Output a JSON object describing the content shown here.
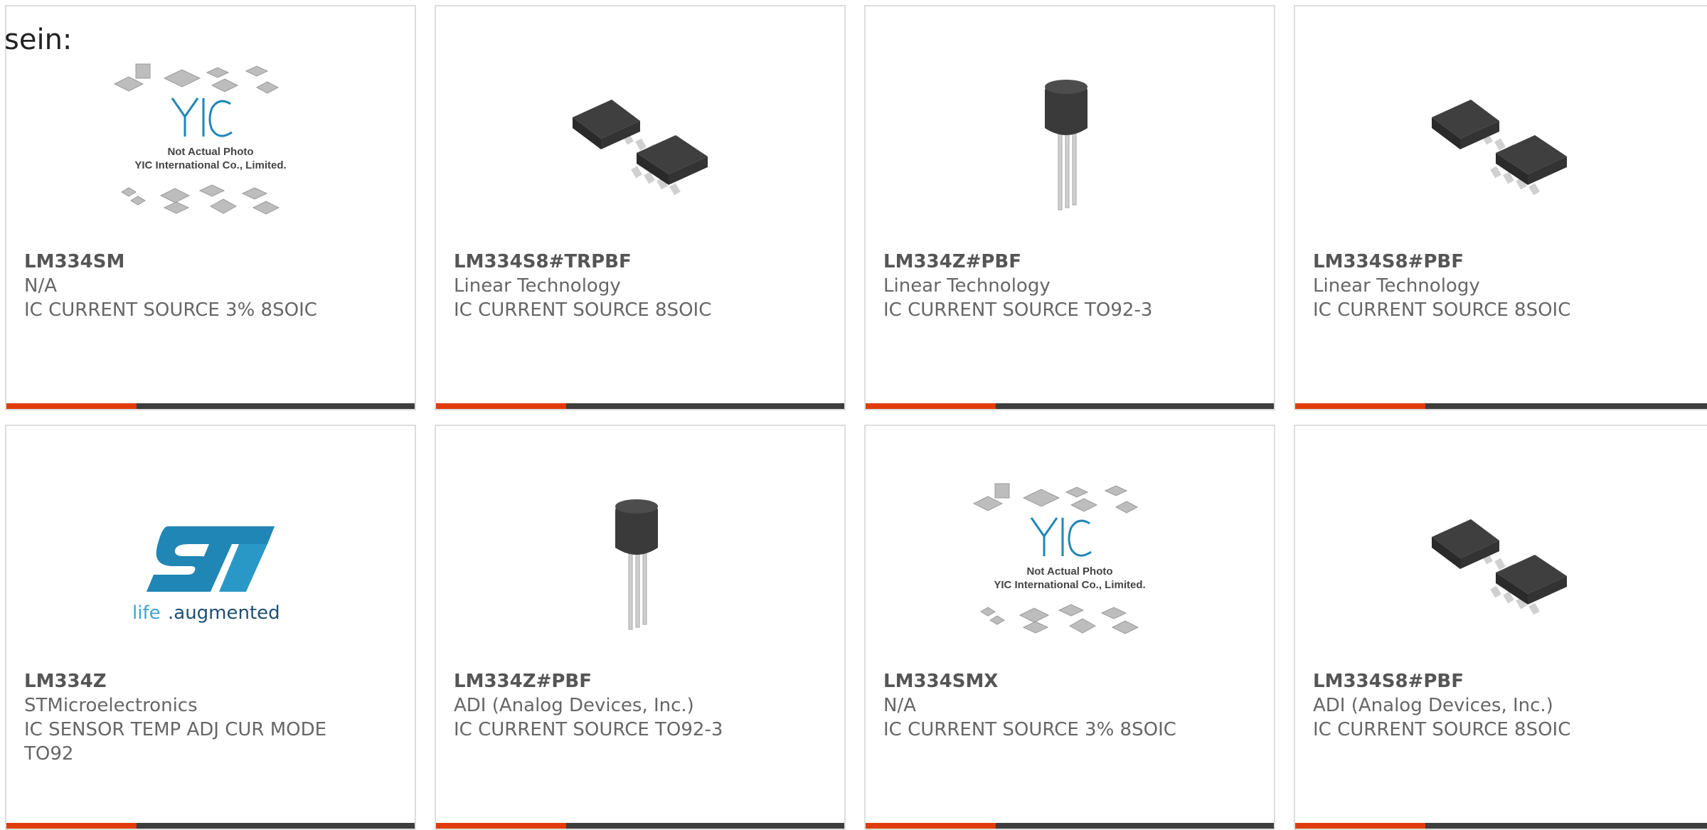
{
  "heading": "sein:",
  "placeholder_caption": {
    "line1": "Not Actual Photo",
    "line2": "YIC International Co., Limited.",
    "logo_text": "YIC"
  },
  "st_tagline": {
    "life": "life",
    "augmented": ".augmented"
  },
  "colors": {
    "accent": "#e03c0b",
    "bar_dark": "#3d3d3d",
    "card_border": "#dddddd",
    "text": "#666666",
    "st_blue": "#1f86b5"
  },
  "products": [
    {
      "part": "LM334SM",
      "manufacturer": "N/A",
      "description": "IC CURRENT SOURCE 3% 8SOIC",
      "image": "yic-placeholder"
    },
    {
      "part": "LM334S8#TRPBF",
      "manufacturer": "Linear Technology",
      "description": "IC CURRENT SOURCE 8SOIC",
      "image": "soic8-chip"
    },
    {
      "part": "LM334Z#PBF",
      "manufacturer": "Linear Technology",
      "description": "IC CURRENT SOURCE TO92-3",
      "image": "to92-transistor"
    },
    {
      "part": "LM334S8#PBF",
      "manufacturer": "Linear Technology",
      "description": "IC CURRENT SOURCE 8SOIC",
      "image": "soic8-chip"
    },
    {
      "part": "LM334Z",
      "manufacturer": "STMicroelectronics",
      "description": "IC SENSOR TEMP ADJ CUR MODE TO92",
      "image": "st-logo"
    },
    {
      "part": "LM334Z#PBF",
      "manufacturer": "ADI (Analog Devices, Inc.)",
      "description": "IC CURRENT SOURCE TO92-3",
      "image": "to92-transistor"
    },
    {
      "part": "LM334SMX",
      "manufacturer": "N/A",
      "description": "IC CURRENT SOURCE 3% 8SOIC",
      "image": "yic-placeholder"
    },
    {
      "part": "LM334S8#PBF",
      "manufacturer": "ADI (Analog Devices, Inc.)",
      "description": "IC CURRENT SOURCE 8SOIC",
      "image": "soic8-chip"
    }
  ]
}
